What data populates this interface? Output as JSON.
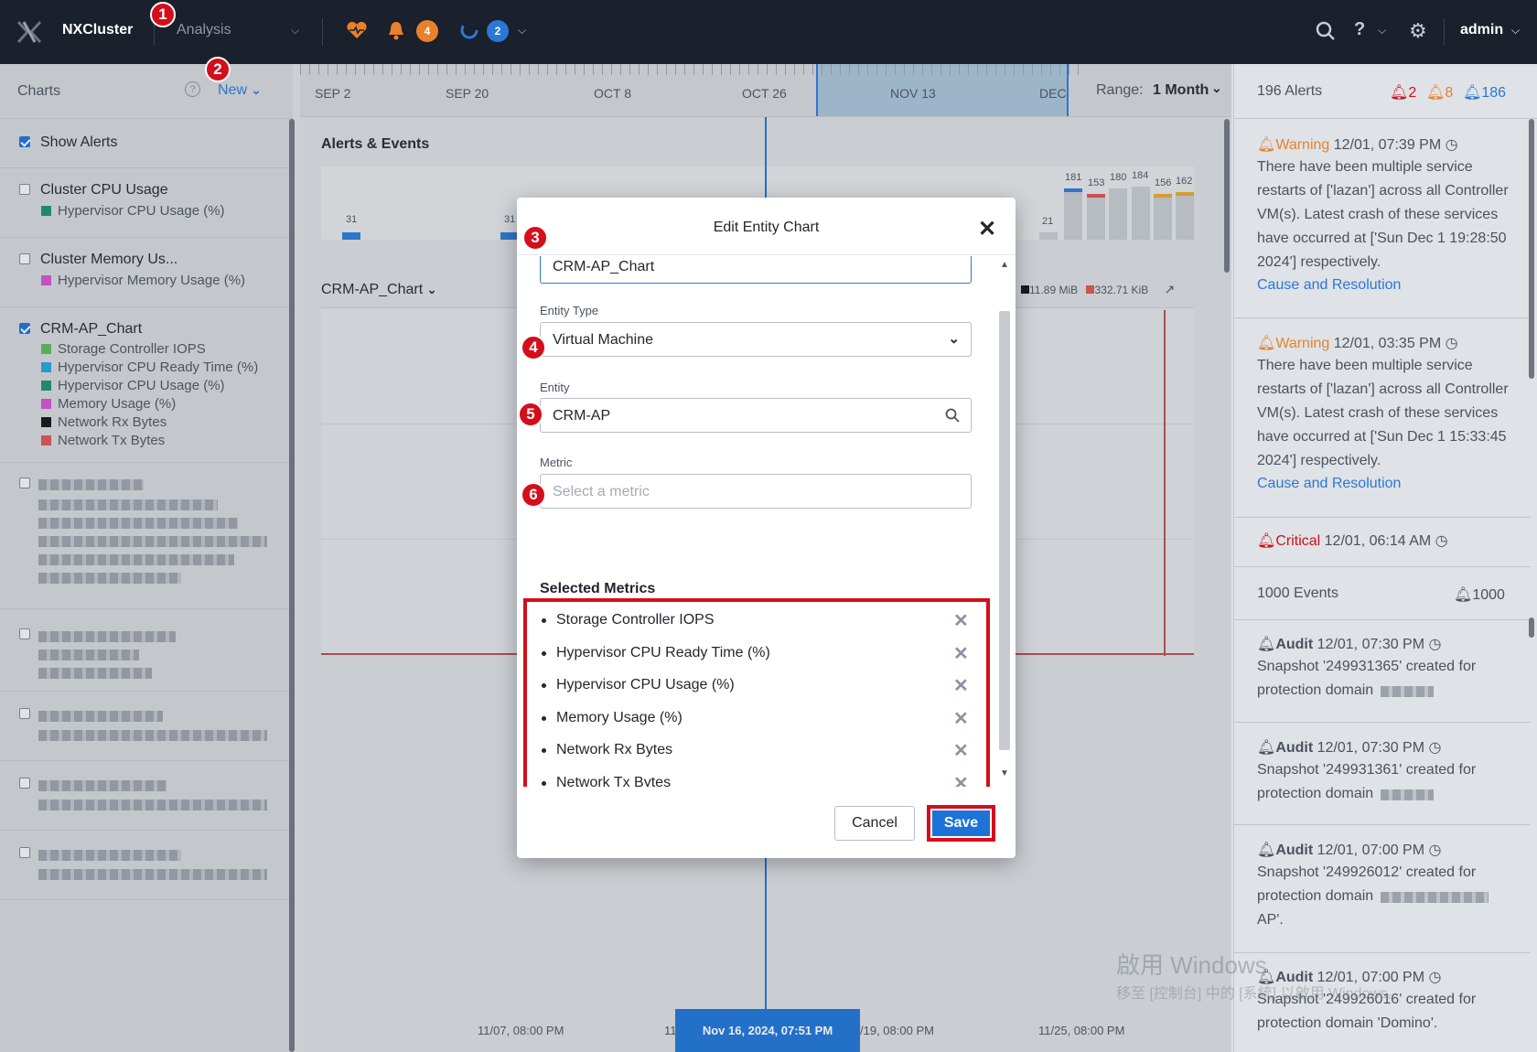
{
  "topbar": {
    "cluster_name": "NXCluster",
    "section": "Analysis",
    "alert_count": "4",
    "task_count": "2",
    "user": "admin",
    "icons": [
      "health-heart-icon",
      "bell-icon",
      "tasks-circle-icon",
      "search-icon",
      "help-icon",
      "gear-icon"
    ]
  },
  "markers": [
    "1",
    "2",
    "3",
    "4",
    "5",
    "6"
  ],
  "sidebar": {
    "title": "Charts",
    "new_label": "New",
    "show_alerts": "Show Alerts",
    "groups": [
      {
        "label": "Cluster CPU Usage",
        "checked": false,
        "metrics": [
          {
            "label": "Hypervisor CPU Usage (%)",
            "color": "#1a8f6a"
          }
        ]
      },
      {
        "label": "Cluster Memory Us...",
        "checked": false,
        "metrics": [
          {
            "label": "Hypervisor Memory Usage (%)",
            "color": "#d44fd0"
          }
        ]
      },
      {
        "label": "CRM-AP_Chart",
        "checked": true,
        "metrics": [
          {
            "label": "Storage Controller IOPS",
            "color": "#5cb85c"
          },
          {
            "label": "Hypervisor CPU Ready Time (%)",
            "color": "#1fa4d8"
          },
          {
            "label": "Hypervisor CPU Usage (%)",
            "color": "#1a8f6a"
          },
          {
            "label": "Memory Usage (%)",
            "color": "#d44fd0"
          },
          {
            "label": "Network Rx Bytes",
            "color": "#111111"
          },
          {
            "label": "Network Tx Bytes",
            "color": "#d9534f"
          }
        ]
      }
    ]
  },
  "timeline": {
    "labels": [
      "SEP 2",
      "SEP 20",
      "OCT 8",
      "OCT 26",
      "NOV 13",
      "DEC"
    ],
    "range_label": "Range:",
    "range_value": "1 Month"
  },
  "main": {
    "alerts_events_title": "Alerts & Events",
    "chart_title": "CRM-AP_Chart",
    "legend_rx": "11.89 MiB",
    "legend_tx": "332.71 KiB",
    "event_bar_values": [
      "31",
      "31",
      "21",
      "181",
      "153",
      "180",
      "184",
      "156",
      "162"
    ],
    "x_labels": [
      "11/07, 08:00 PM",
      "11",
      "/19, 08:00 PM",
      "11/25, 08:00 PM"
    ],
    "cursor_time": "Nov 16, 2024, 07:51 PM"
  },
  "right_panel": {
    "alert_total": "196 Alerts",
    "critical_count": "2",
    "warning_count": "8",
    "info_count": "186",
    "events_total": "1000 Events",
    "events_count": "1000",
    "items": [
      {
        "severity": "Warning",
        "time": "12/01, 07:39 PM",
        "body": "There have been multiple service restarts of ['lazan'] across all Controller VM(s). Latest crash of these services have occurred at ['Sun Dec 1 19:28:50 2024'] respectively.",
        "link": "Cause and Resolution"
      },
      {
        "severity": "Warning",
        "time": "12/01, 03:35 PM",
        "body": "There have been multiple service restarts of ['lazan'] across all Controller VM(s). Latest crash of these services have occurred at ['Sun Dec 1 15:33:45 2024'] respectively.",
        "link": "Cause and Resolution"
      },
      {
        "severity": "Critical",
        "time": "12/01, 06:14 AM"
      }
    ],
    "events": [
      {
        "type": "Audit",
        "time": "12/01, 07:30 PM",
        "body": "Snapshot '249931365' created for protection domain"
      },
      {
        "type": "Audit",
        "time": "12/01, 07:30 PM",
        "body": "Snapshot '249931361' created for protection domain"
      },
      {
        "type": "Audit",
        "time": "12/01, 07:00 PM",
        "body": "Snapshot '249926012' created for protection domain",
        "tail": "AP'."
      },
      {
        "type": "Audit",
        "time": "12/01, 07:00 PM",
        "body": "Snapshot '249926016' created for protection domain 'Domino'."
      }
    ],
    "watermark": "啟用 Windows",
    "watermark_sub": "移至 [控制台] 中的 [系統] 以啟用 Windows。"
  },
  "modal": {
    "title": "Edit Entity Chart",
    "chart_name_value": "CRM-AP_Chart",
    "entity_type_label": "Entity Type",
    "entity_type_value": "Virtual Machine",
    "entity_label": "Entity",
    "entity_value": "CRM-AP",
    "metric_label": "Metric",
    "metric_placeholder": "Select a metric",
    "selected_title": "Selected Metrics",
    "selected_metrics": [
      "Storage Controller IOPS",
      "Hypervisor CPU Ready Time (%)",
      "Hypervisor CPU Usage (%)",
      "Memory Usage (%)",
      "Network Rx Bytes",
      "Network Tx Bytes"
    ],
    "cancel_label": "Cancel",
    "save_label": "Save"
  }
}
